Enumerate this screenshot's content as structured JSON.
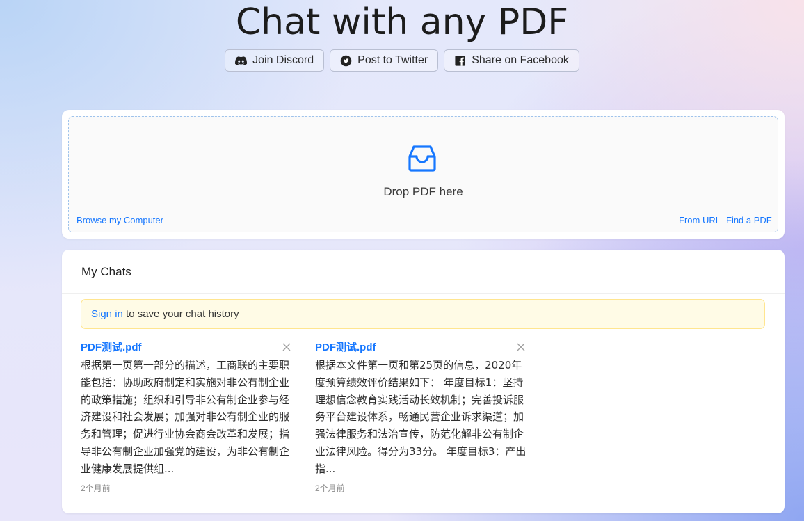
{
  "header": {
    "title": "Chat with any PDF"
  },
  "share_buttons": [
    {
      "label": "Join Discord",
      "icon": "discord-icon"
    },
    {
      "label": "Post to Twitter",
      "icon": "twitter-icon"
    },
    {
      "label": "Share on Facebook",
      "icon": "facebook-icon"
    }
  ],
  "upload": {
    "drop_text": "Drop PDF here",
    "browse_label": "Browse my Computer",
    "from_url_label": "From URL",
    "find_pdf_label": "Find a PDF",
    "icon": "inbox-icon"
  },
  "chats": {
    "heading": "My Chats",
    "notice_link": "Sign in",
    "notice_text": " to save your chat history",
    "items": [
      {
        "name": "PDF测试.pdf",
        "summary": "根据第一页第一部分的描述，工商联的主要职能包括：协助政府制定和实施对非公有制企业的政策措施；组织和引导非公有制企业参与经济建设和社会发展；加强对非公有制企业的服务和管理；促进行业协会商会改革和发展；指导非公有制企业加强党的建设，为非公有制企业健康发展提供组...",
        "time": "2个月前"
      },
      {
        "name": "PDF测试.pdf",
        "summary": "根据本文件第一页和第25页的信息，2020年度预算绩效评价结果如下： 年度目标1：坚持理想信念教育实践活动长效机制；完善投诉服务平台建设体系，畅通民营企业诉求渠道；加强法律服务和法治宣传，防范化解非公有制企业法律风险。得分为33分。 年度目标3：产出指...",
        "time": "2个月前"
      }
    ]
  },
  "colors": {
    "accent": "#1677ff",
    "notice_bg": "#fffbe6",
    "notice_border": "#ffe58f"
  }
}
